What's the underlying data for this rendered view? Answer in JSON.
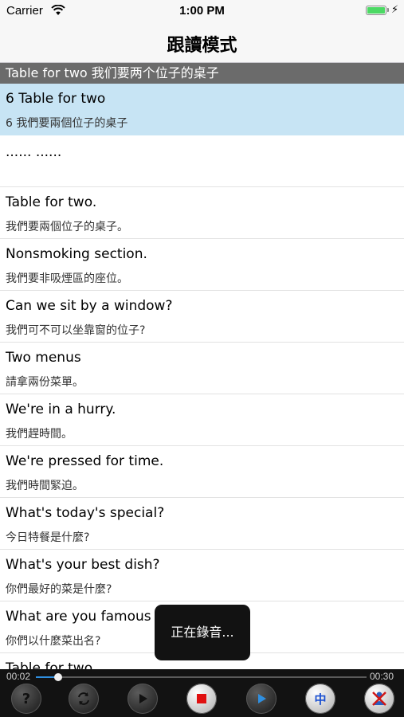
{
  "status_bar": {
    "carrier": "Carrier",
    "time": "1:00 PM"
  },
  "nav": {
    "title": "跟讀模式"
  },
  "section_header": "Table for two 我们要两个位子的桌子",
  "rows": [
    {
      "en": "6 Table for two",
      "zh": "6 我們要兩個位子的桌子"
    },
    {
      "en": "...... ......",
      "zh": ""
    },
    {
      "en": "Table for two.",
      "zh": "我們要兩個位子的桌子。"
    },
    {
      "en": "Nonsmoking section.",
      "zh": "我們要非吸煙區的座位。"
    },
    {
      "en": "Can we sit by a window?",
      "zh": "我們可不可以坐靠窗的位子?"
    },
    {
      "en": "Two menus",
      "zh": "請拿兩份菜單。"
    },
    {
      "en": "We're in a hurry.",
      "zh": "我們趕時間。"
    },
    {
      "en": "We're pressed for time.",
      "zh": "我們時間緊迫。"
    },
    {
      "en": "What's today's special?",
      "zh": "今日特餐是什麼?"
    },
    {
      "en": "What's your best dish?",
      "zh": "你們最好的菜是什麼?"
    },
    {
      "en": "What are you famous for?",
      "zh": "你們以什麼菜出名?"
    },
    {
      "en": "Table for two.",
      "zh": ""
    }
  ],
  "toast": "正在錄音...",
  "player": {
    "current_time": "00:02",
    "total_time": "00:30",
    "progress": 0.067,
    "buttons": {
      "help": "?",
      "chinese": "中"
    }
  },
  "colors": {
    "selected_row": "#c7e4f4",
    "section_header": "#6b6b6b",
    "accent": "#2f8fe0",
    "battery": "#4cd964",
    "record_stop": "#e01010"
  }
}
